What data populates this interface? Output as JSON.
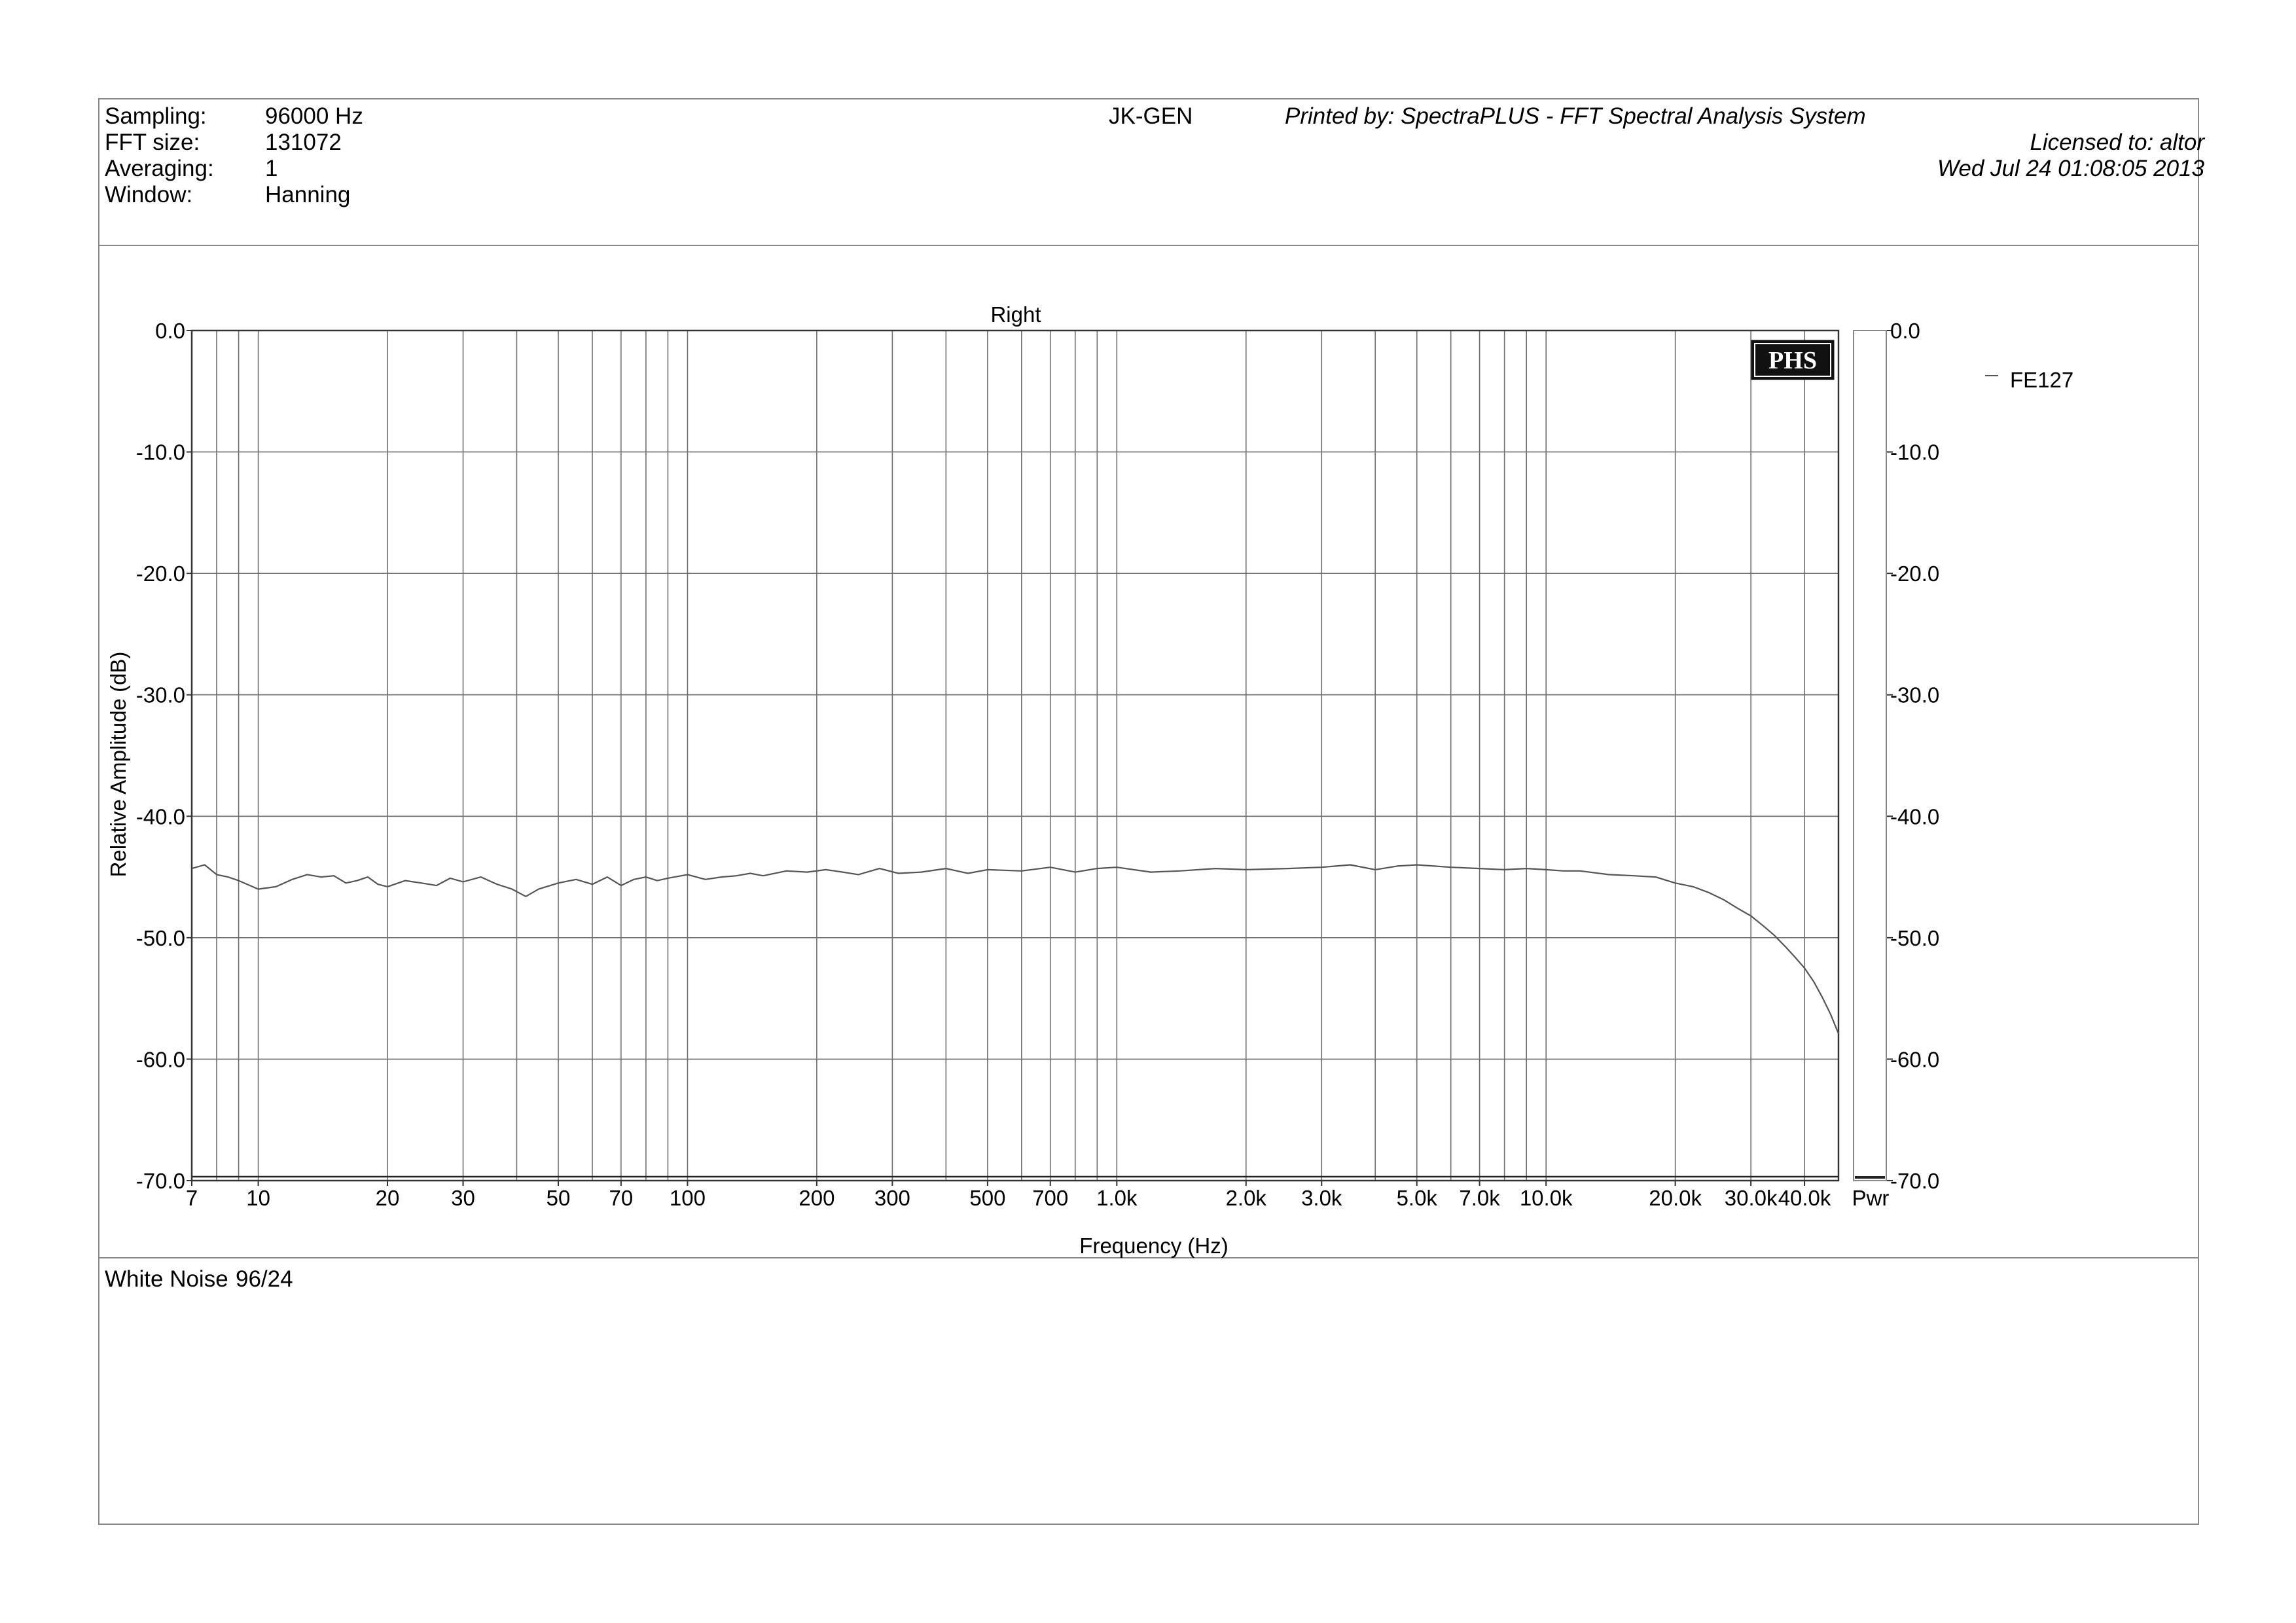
{
  "header": {
    "params": [
      {
        "label": "Sampling:",
        "value": "96000 Hz"
      },
      {
        "label": "FFT size:",
        "value": "131072"
      },
      {
        "label": "Averaging:",
        "value": "1"
      },
      {
        "label": "Window:",
        "value": "Hanning"
      }
    ],
    "device": "JK-GEN",
    "printed_by": "Printed by: SpectraPLUS - FFT Spectral Analysis System",
    "licensed_to": "Licensed to: altor",
    "timestamp": "Wed Jul 24 01:08:05 2013"
  },
  "footer": {
    "note": "White Noise",
    "note_value": "96/24"
  },
  "logo_text": "PHS",
  "pwr_label": "Pwr",
  "chart_data": {
    "type": "line",
    "title": "Right",
    "xlabel": "Frequency (Hz)",
    "ylabel": "Relative Amplitude (dB)",
    "x_scale": "log",
    "xlim": [
      7,
      48000
    ],
    "ylim": [
      -70,
      0
    ],
    "grid": true,
    "legend_position": "right",
    "x_tick_labels": [
      {
        "v": 7,
        "t": "7"
      },
      {
        "v": 10,
        "t": "10"
      },
      {
        "v": 20,
        "t": "20"
      },
      {
        "v": 30,
        "t": "30"
      },
      {
        "v": 50,
        "t": "50"
      },
      {
        "v": 70,
        "t": "70"
      },
      {
        "v": 100,
        "t": "100"
      },
      {
        "v": 200,
        "t": "200"
      },
      {
        "v": 300,
        "t": "300"
      },
      {
        "v": 500,
        "t": "500"
      },
      {
        "v": 700,
        "t": "700"
      },
      {
        "v": 1000,
        "t": "1.0k"
      },
      {
        "v": 2000,
        "t": "2.0k"
      },
      {
        "v": 3000,
        "t": "3.0k"
      },
      {
        "v": 5000,
        "t": "5.0k"
      },
      {
        "v": 7000,
        "t": "7.0k"
      },
      {
        "v": 10000,
        "t": "10.0k"
      },
      {
        "v": 20000,
        "t": "20.0k"
      },
      {
        "v": 30000,
        "t": "30.0k"
      },
      {
        "v": 40000,
        "t": "40.0k"
      }
    ],
    "x_grid": [
      8,
      9,
      10,
      20,
      30,
      40,
      50,
      60,
      70,
      80,
      90,
      100,
      200,
      300,
      400,
      500,
      600,
      700,
      800,
      900,
      1000,
      2000,
      3000,
      4000,
      5000,
      6000,
      7000,
      8000,
      9000,
      10000,
      20000,
      30000,
      40000
    ],
    "y_ticks": [
      {
        "v": 0,
        "t": "0.0"
      },
      {
        "v": -10,
        "t": "-10.0"
      },
      {
        "v": -20,
        "t": "-20.0"
      },
      {
        "v": -30,
        "t": "-30.0"
      },
      {
        "v": -40,
        "t": "-40.0"
      },
      {
        "v": -50,
        "t": "-50.0"
      },
      {
        "v": -60,
        "t": "-60.0"
      },
      {
        "v": -70,
        "t": "-70.0"
      }
    ],
    "pwr_value": -70,
    "series": [
      {
        "name": "FE127",
        "color": "#555555",
        "x": [
          7,
          7.5,
          8,
          8.5,
          9,
          10,
          11,
          12,
          13,
          14,
          15,
          16,
          17,
          18,
          19,
          20,
          22,
          24,
          26,
          28,
          30,
          33,
          36,
          39,
          42,
          45,
          50,
          55,
          60,
          65,
          70,
          75,
          80,
          85,
          90,
          100,
          110,
          120,
          130,
          140,
          150,
          170,
          190,
          210,
          230,
          250,
          280,
          310,
          350,
          400,
          450,
          500,
          600,
          700,
          800,
          900,
          1000,
          1200,
          1400,
          1700,
          2000,
          2500,
          3000,
          3500,
          4000,
          4500,
          5000,
          6000,
          7000,
          8000,
          9000,
          10000,
          11000,
          12000,
          14000,
          16000,
          18000,
          20000,
          22000,
          24000,
          26000,
          28000,
          30000,
          32000,
          34000,
          36000,
          38000,
          40000,
          42000,
          44000,
          46000,
          48000
        ],
        "y": [
          -44.3,
          -44.0,
          -44.8,
          -45.0,
          -45.3,
          -46.0,
          -45.8,
          -45.2,
          -44.8,
          -45.0,
          -44.9,
          -45.5,
          -45.3,
          -45.0,
          -45.6,
          -45.8,
          -45.3,
          -45.5,
          -45.7,
          -45.1,
          -45.4,
          -45.0,
          -45.6,
          -46.0,
          -46.6,
          -46.0,
          -45.5,
          -45.2,
          -45.6,
          -45.0,
          -45.7,
          -45.2,
          -45.0,
          -45.3,
          -45.1,
          -44.8,
          -45.2,
          -45.0,
          -44.9,
          -44.7,
          -44.9,
          -44.5,
          -44.6,
          -44.4,
          -44.6,
          -44.8,
          -44.3,
          -44.7,
          -44.6,
          -44.3,
          -44.7,
          -44.4,
          -44.5,
          -44.2,
          -44.6,
          -44.3,
          -44.2,
          -44.6,
          -44.5,
          -44.3,
          -44.4,
          -44.3,
          -44.2,
          -44.0,
          -44.4,
          -44.1,
          -44.0,
          -44.2,
          -44.3,
          -44.4,
          -44.3,
          -44.4,
          -44.5,
          -44.5,
          -44.8,
          -44.9,
          -45.0,
          -45.5,
          -45.8,
          -46.3,
          -46.9,
          -47.6,
          -48.2,
          -49.0,
          -49.8,
          -50.7,
          -51.6,
          -52.5,
          -53.6,
          -54.9,
          -56.3,
          -57.9
        ]
      }
    ]
  }
}
